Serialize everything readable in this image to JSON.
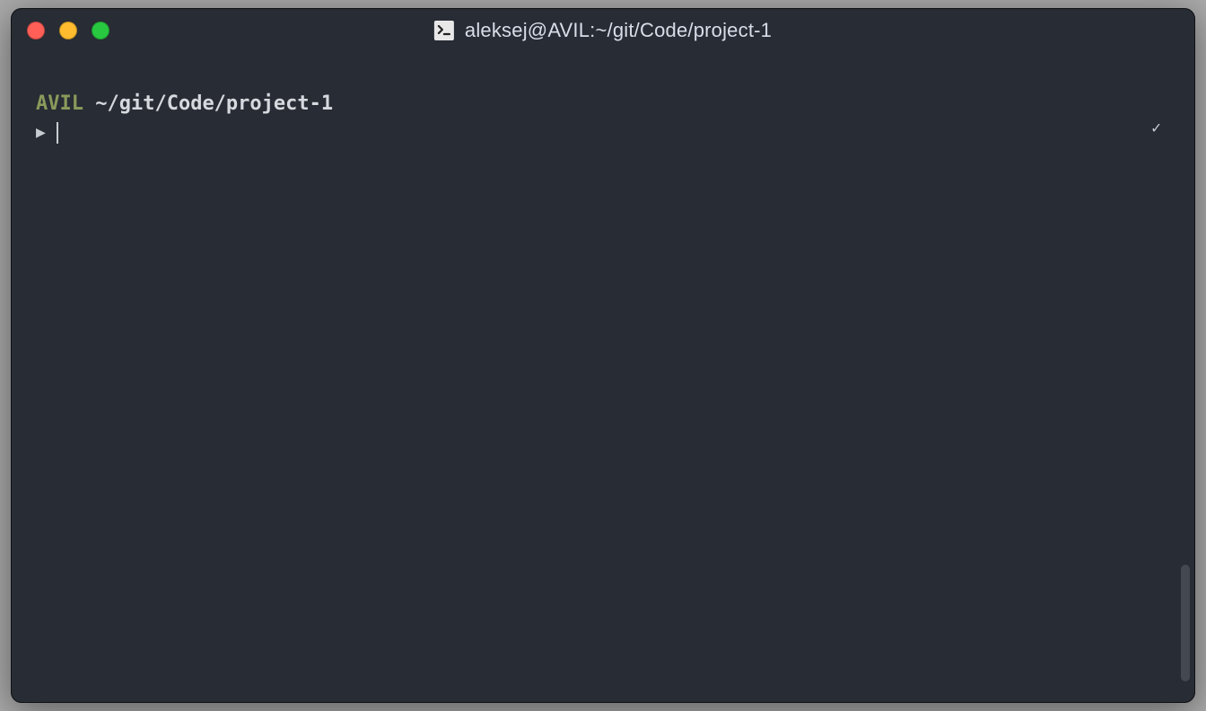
{
  "window": {
    "title": "aleksej@AVIL:~/git/Code/project-1",
    "icon": "terminal-icon"
  },
  "prompt": {
    "host": "AVIL",
    "separator": " ",
    "cwd": "~/git/Code/project-1",
    "arrow": "▶",
    "input_value": "",
    "status_ok": "✓"
  },
  "colors": {
    "bg": "#282c34",
    "host": "#8a9a5b",
    "text": "#d6d9de",
    "traffic_close": "#ff5f57",
    "traffic_min": "#febc2e",
    "traffic_max": "#28c840"
  }
}
